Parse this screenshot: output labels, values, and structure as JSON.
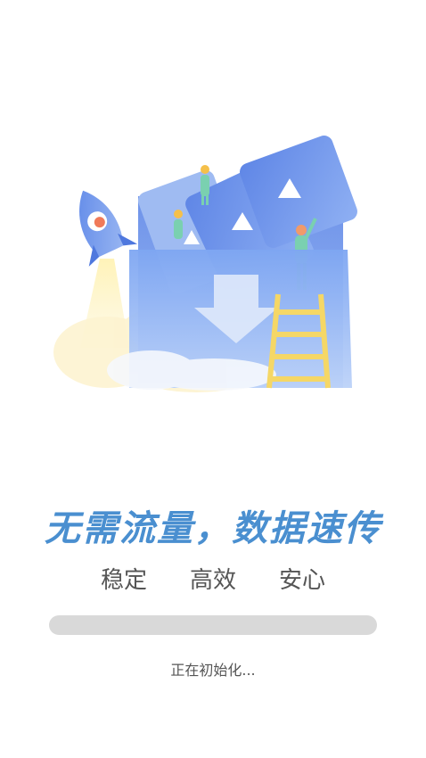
{
  "splash": {
    "headline": "无需流量，数据速传",
    "features": [
      "稳定",
      "高效",
      "安心"
    ],
    "progress": 0,
    "status": "正在初始化...",
    "colors": {
      "headline": "#4a8fd0",
      "track": "#d9d9d9",
      "text": "#555555"
    }
  }
}
